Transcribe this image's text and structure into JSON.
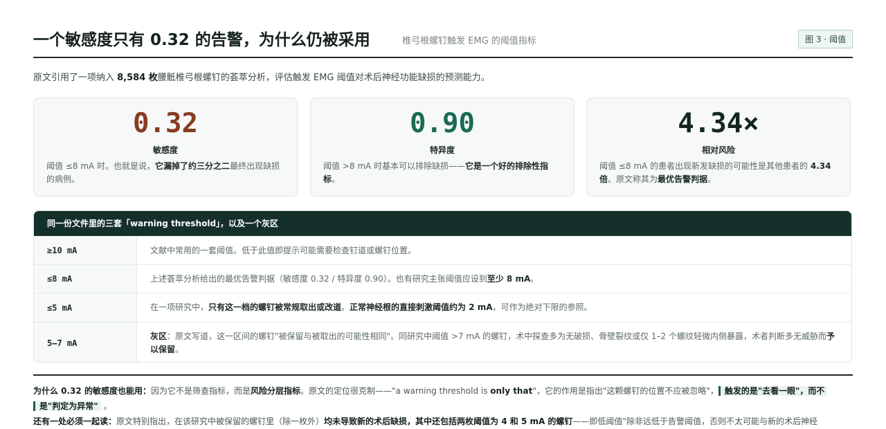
{
  "header": {
    "title": "一个敏感度只有 0.32 的告警，为什么仍被采用",
    "subtitle": "椎弓根螺钉触发 EMG 的阈值指标",
    "figure_tag": "图 3 · 阈值"
  },
  "intro": {
    "prefix": "原文引用了一项纳入 ",
    "count": "8,584 枚",
    "suffix": "腰骶椎弓根螺钉的荟萃分析，评估触发 EMG 阈值对术后神经功能缺损的预测能力。"
  },
  "metrics": [
    {
      "value": "0.32",
      "color": "#8a3a1f",
      "label": "敏感度",
      "desc_a": "阈值 ≤8 mA 时。也就是说，",
      "desc_b": "它漏掉了约三分之二",
      "desc_c": "最终出现缺损的病例。"
    },
    {
      "value": "0.90",
      "color": "#1b6a56",
      "label": "特异度",
      "desc_a": "阈值 >8 mA 时基本可以排除缺损——",
      "desc_b": "它是一个好的排除性指标",
      "desc_c": "。"
    },
    {
      "value": "4.34×",
      "color": "#13261f",
      "label": "相对风险",
      "desc_a": "阈值 ≤8 mA 的患者出现新发缺损的可能性是其他患者的 ",
      "desc_b": "4.34 倍",
      "desc_c": "。原文称其为",
      "desc_d": "最优告警判据",
      "desc_e": "。"
    }
  ],
  "table": {
    "heading": "同一份文件里的三套「warning threshold」，以及一个灰区",
    "rows": [
      {
        "key": "≥10 mA",
        "text_a": "文献中常用的一套阈值。低于此值即提示可能需要检查钉道或螺钉位置。"
      },
      {
        "key": "≤8 mA",
        "text_a": "上述荟萃分析给出的最优告警判据（敏感度 0.32 / 特异度 0.90）。也有研究主张阈值应设到",
        "text_b": "至少 8 mA",
        "text_c": "。"
      },
      {
        "key": "≤5 mA",
        "text_a": "在一项研究中，",
        "text_b": "只有这一档的螺钉被常规取出或改道",
        "text_c": "。",
        "text_d": "正常神经根的直接刺激阈值约为 2 mA",
        "text_e": "，可作为绝对下限的参照。"
      },
      {
        "key": "5–7 mA",
        "text_b": "灰区",
        "text_c": "：原文写道，这一区间的螺钉\"被保留与被取出的可能性相同\"。同研究中阈值 >7 mA 的螺钉，术中探查多为无破损、骨壁裂纹或仅 1–2 个螺纹轻微内侧暴露，术者判断多无威胁而",
        "text_d": "予以保留",
        "text_e": "。"
      }
    ]
  },
  "footer": {
    "p1_lead": "为什么 0.32 的敏感度也能用：",
    "p1_a": "因为它不是筛查指标，而是",
    "p1_b": "风险分层指标",
    "p1_c": "。原文的定位很克制——\"a warning threshold is ",
    "p1_d": "only that",
    "p1_e": "\"，它的作用是指出\"这颗螺钉的位置不应被忽略\"，",
    "p1_hl1": "触发的是\"去看一眼\"，而不",
    "p1_hl2": "是\"判定为异常\"",
    "p1_end": "。",
    "p2_lead": "还有一处必须一起读：",
    "p2_a": "原文特别指出，在该研究中被保留的螺钉里（除一枚外）",
    "p2_b": "均未导致新的术后缺损，其中还包括两枚阈值为 4 和 5 mA 的螺钉",
    "p2_c": "——即低阈值\"除非远低于告警阈值，否则不太可能与新的术后神经"
  }
}
